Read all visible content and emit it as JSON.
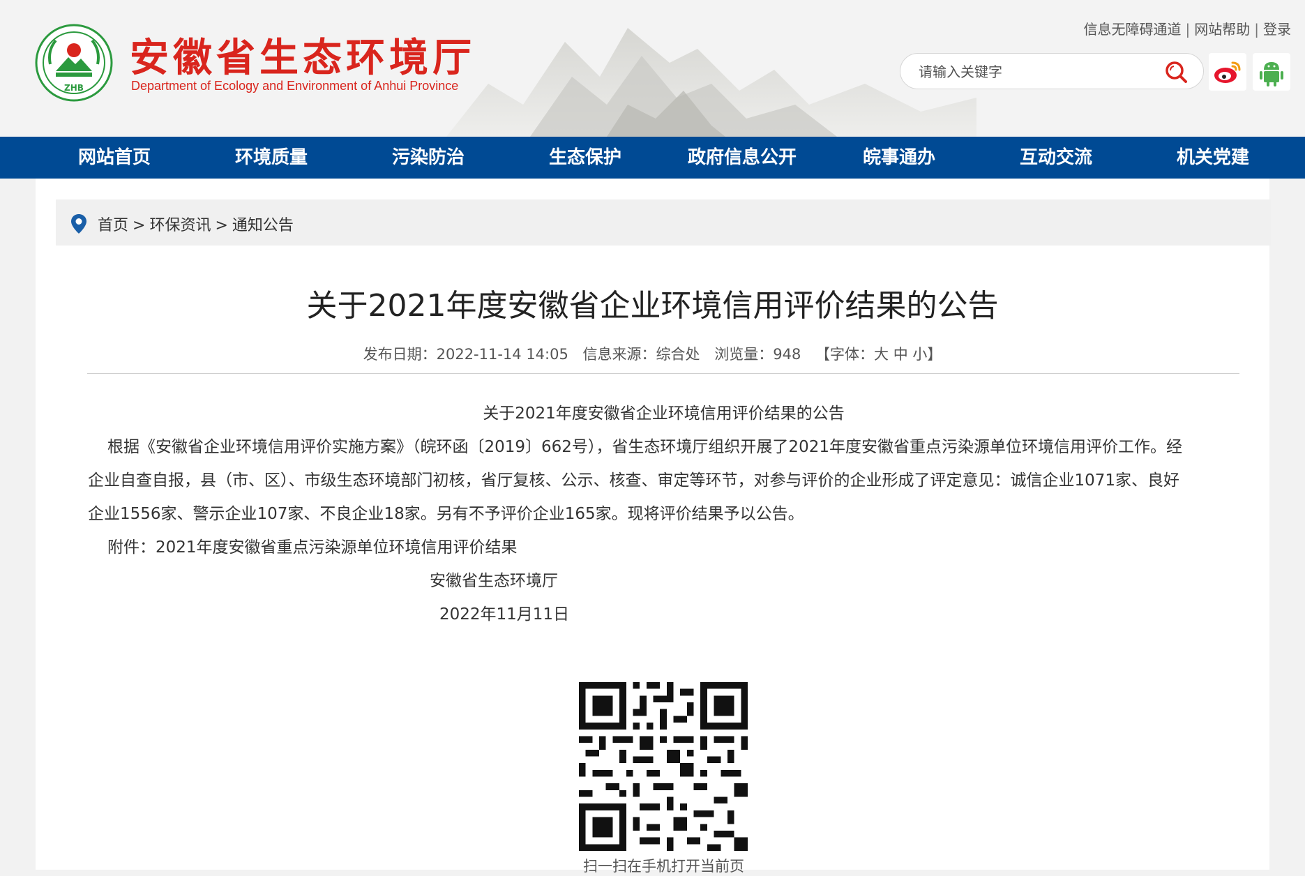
{
  "header": {
    "title": "安徽省生态环境厅",
    "subtitle": "Department of Ecology and Environment of Anhui Province",
    "logo_text": "ZHB",
    "top_links": [
      "信息无障碍通道",
      "网站帮助",
      "登录"
    ],
    "search_placeholder": "请输入关键字",
    "icons": [
      "search-icon",
      "weibo-icon",
      "android-icon"
    ]
  },
  "nav": [
    "网站首页",
    "环境质量",
    "污染防治",
    "生态保护",
    "政府信息公开",
    "皖事通办",
    "互动交流",
    "机关党建"
  ],
  "breadcrumb": [
    "首页",
    "环保资讯",
    "通知公告"
  ],
  "article": {
    "title": "关于2021年度安徽省企业环境信用评价结果的公告",
    "publish_date": "发布日期：2022-11-14 14:05",
    "source": "信息来源：综合处",
    "views": "浏览量：948",
    "font_size": "【字体：大 中 小】",
    "content_title": "关于2021年度安徽省企业环境信用评价结果的公告",
    "para1_line1": "根据《安徽省企业环境信用评价实施方案》（皖环函〔2019〕662号），省生态环境厅组织开展了2021年度安徽省重点污染源单位环境信用评价工作。经",
    "para1_line2": "企业自查自报，县（市、区）、市级生态环境部门初核，省厅复核、公示、核查、审定等环节，对参与评价的企业形成了评定意见：诚信企业1071家、良好",
    "para1_line3": "企业1556家、警示企业107家、不良企业18家。另有不予评价企业165家。现将评价结果予以公告。",
    "attachment": "附件：2021年度安徽省重点污染源单位环境信用评价结果",
    "signature": "安徽省生态环境厅",
    "date": "2022年11月11日",
    "qr_caption": "扫一扫在手机打开当前页"
  },
  "colors": {
    "nav_bg": "#004a94",
    "title_red": "#d9251d"
  }
}
